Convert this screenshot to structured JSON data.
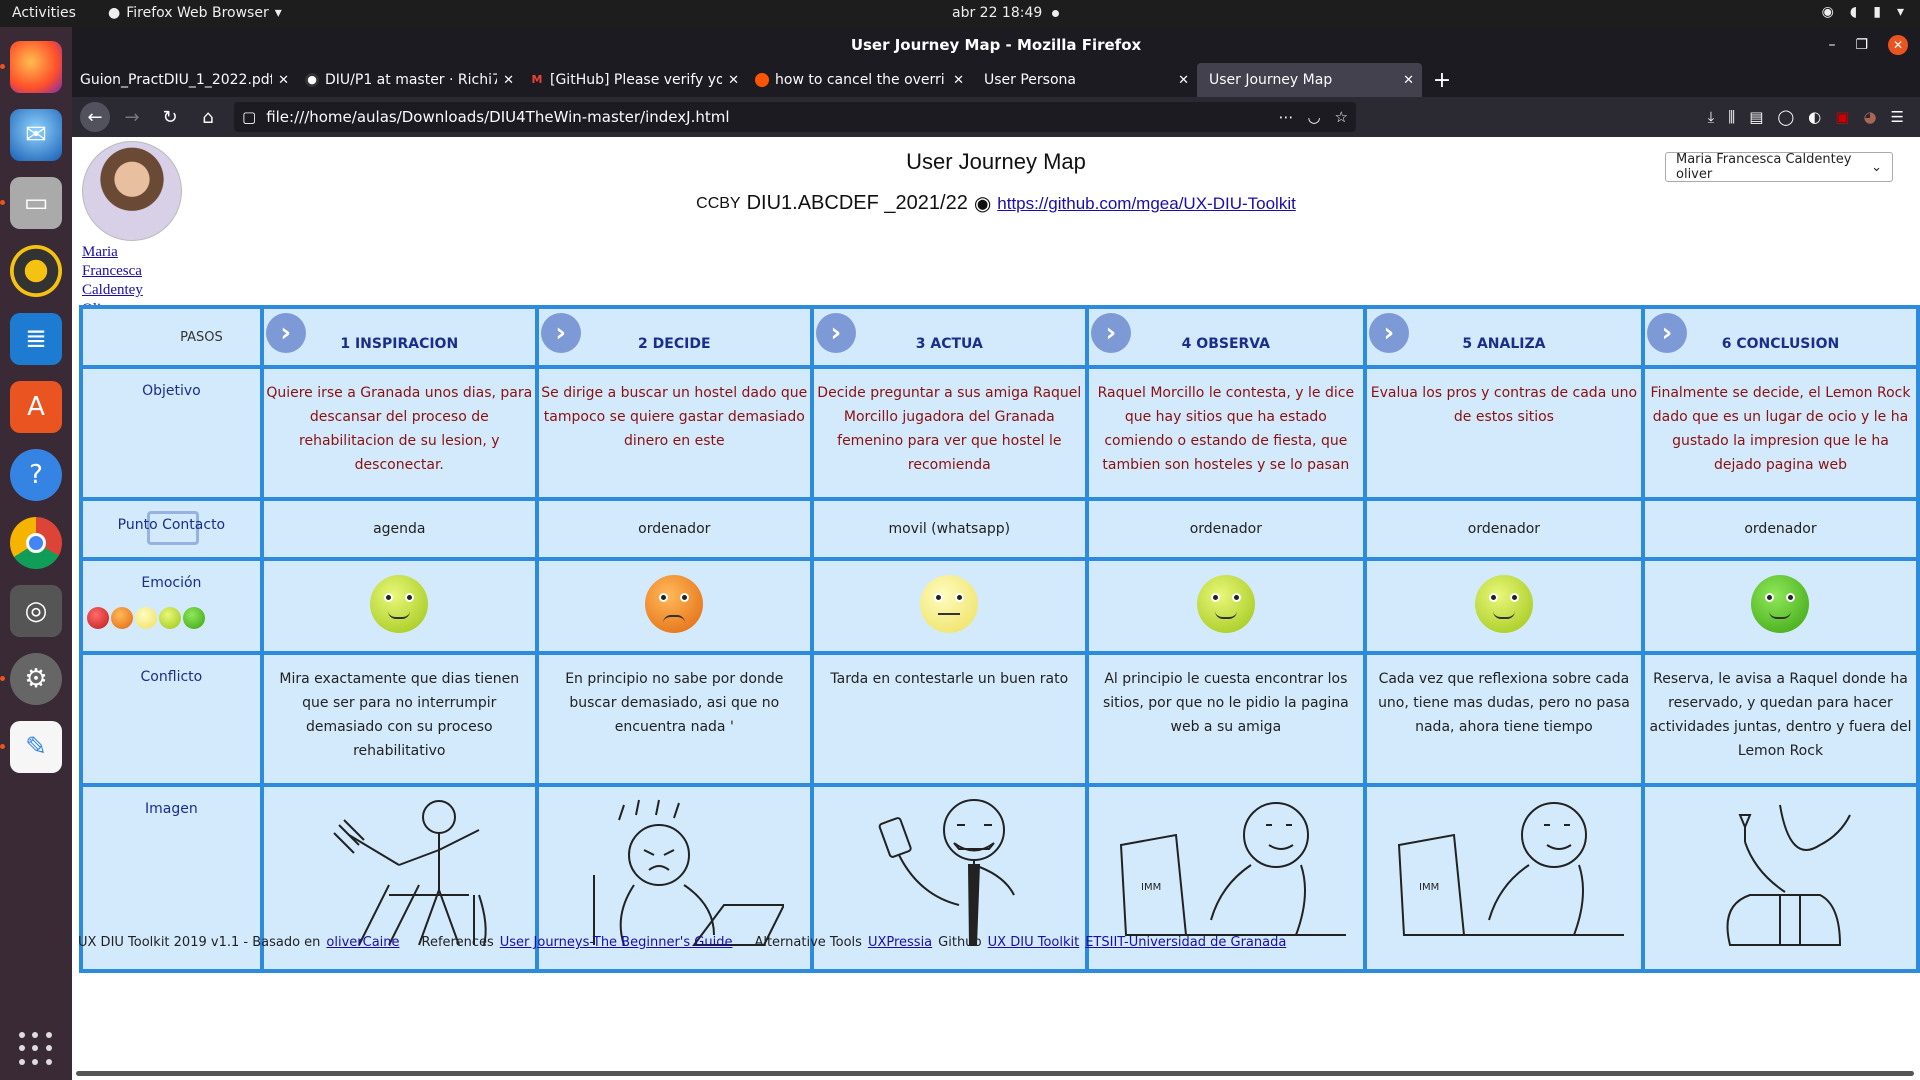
{
  "topbar": {
    "activities": "Activities",
    "app_name": "Firefox Web Browser",
    "clock": "abr 22  18:49"
  },
  "window": {
    "title": "User Journey Map - Mozilla Firefox"
  },
  "tabs": [
    {
      "label": "Guion_PractDIU_1_2022.pdf",
      "active": false
    },
    {
      "label": "DIU/P1 at master · Richi7",
      "active": false
    },
    {
      "label": "[GitHub] Please verify yo",
      "active": false
    },
    {
      "label": "how to cancel the overri",
      "active": false
    },
    {
      "label": "User Persona",
      "active": false
    },
    {
      "label": "User Journey Map",
      "active": true
    }
  ],
  "navbar": {
    "url": "file:///home/aulas/Downloads/DIU4TheWin-master/indexJ.html"
  },
  "page": {
    "title": "User Journey Map",
    "cc": "CCBY",
    "course": "DIU1.ABCDEF _2021/22",
    "repo_link": "https://github.com/mgea/UX-DIU-Toolkit",
    "persona_selected": "Maria Francesca Caldentey oliver",
    "persona_name": "Maria Francesca Caldentey Oliver",
    "pasos_label": "PASOS"
  },
  "row_labels": {
    "objetivo": "Objetivo",
    "punto_contacto": "Punto Contacto",
    "emocion": "Emoción",
    "conflicto": "Conflicto",
    "imagen": "Imagen"
  },
  "stages": [
    {
      "label": "1 INSPIRACION",
      "objetivo": "Quiere irse a Granada unos dias, para descansar del proceso de rehabilitacion de su lesion, y desconectar.",
      "contacto": "agenda",
      "emotion": "happy",
      "conflicto": "Mira exactamente que dias tienen que ser para no interrumpir demasiado con su proceso rehabilitativo"
    },
    {
      "label": "2 DECIDE",
      "objetivo": "Se dirige a buscar un hostel dado que tampoco se quiere gastar demasiado dinero en este",
      "contacto": "ordenador",
      "emotion": "angry",
      "conflicto": "En principio no sabe por donde buscar demasiado, asi que no encuentra nada '"
    },
    {
      "label": "3 ACTUA",
      "objetivo": "Decide preguntar a sus amiga Raquel Morcillo jugadora del Granada femenino para ver que hostel le recomienda",
      "contacto": "movil (whatsapp)",
      "emotion": "neutral",
      "conflicto": "Tarda en contestarle un buen rato"
    },
    {
      "label": "4 OBSERVA",
      "objetivo": "Raquel Morcillo le contesta, y le dice que hay sitios que ha estado comiendo o estando de fiesta, que tambien son hosteles y se lo pasan",
      "contacto": "ordenador",
      "emotion": "happy",
      "conflicto": "Al principio le cuesta encontrar los sitios, por que no le pidio la pagina web a su amiga"
    },
    {
      "label": "5 ANALIZA",
      "objetivo": "Evalua los pros y contras de cada uno de estos sitios",
      "contacto": "ordenador",
      "emotion": "happy",
      "conflicto": "Cada vez que reflexiona sobre cada uno, tiene mas dudas, pero no pasa nada, ahora tiene tiempo"
    },
    {
      "label": "6 CONCLUSION",
      "objetivo": "Finalmente se decide, el Lemon Rock dado que es un lugar de ocio y le ha gustado la impresion que le ha dejado pagina web",
      "contacto": "ordenador",
      "emotion": "veryhappy",
      "conflicto": "Reserva, le avisa a Raquel donde ha reservado, y quedan para hacer actividades juntas, dentro y fuera del Lemon Rock"
    }
  ],
  "footer": {
    "prefix": "UX DIU Toolkit 2019 v1.1 - Basado en",
    "link1": "oliverCaine",
    "references": "References",
    "link2": "User Journeys-The Beginner's Guide",
    "alt_tools": "Alternative Tools",
    "link3": "UXPressia",
    "github": "Github",
    "link4": "UX DIU Toolkit",
    "link5": "ETSIIT-Universidad de Granada"
  },
  "colors": {
    "grid_border": "#2c8bdc",
    "cell_bg": "#d3eafc",
    "objetivo_text": "#8b1010",
    "stage_text": "#1a2e8a"
  }
}
